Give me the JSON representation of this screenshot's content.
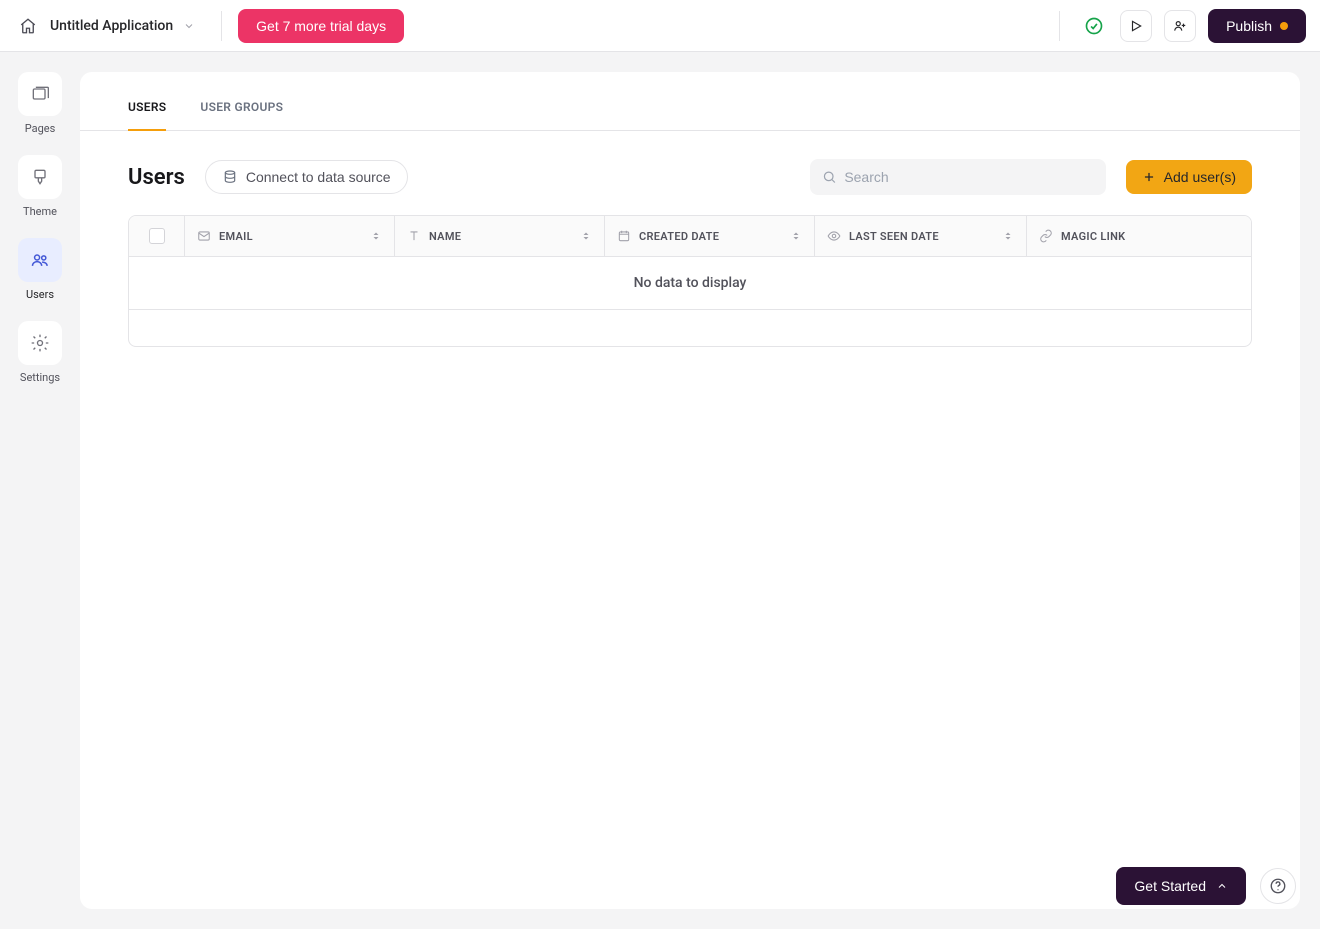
{
  "topbar": {
    "app_title": "Untitled Application",
    "trial_button": "Get 7 more trial days",
    "publish_button": "Publish"
  },
  "sidebar": {
    "pages": "Pages",
    "theme": "Theme",
    "users": "Users",
    "settings": "Settings",
    "active": "users"
  },
  "tabs": {
    "users": "USERS",
    "user_groups": "USER GROUPS",
    "active": "users"
  },
  "page": {
    "title": "Users",
    "datasource_button": "Connect to data source",
    "search_placeholder": "Search",
    "add_user_button": "Add user(s)"
  },
  "table": {
    "columns": {
      "email": "EMAIL",
      "name": "NAME",
      "created_date": "CREATED DATE",
      "last_seen_date": "LAST SEEN DATE",
      "magic_link": "MAGIC LINK"
    },
    "rows": [],
    "empty_message": "No data to display"
  },
  "floating": {
    "get_started": "Get Started"
  },
  "colors": {
    "accent_pink": "#ec3466",
    "accent_amber": "#f2a614",
    "brand_dark": "#2b1235",
    "status_green": "#16a34a",
    "sidebar_active_bg": "#e8edff",
    "sidebar_active_fg": "#4358d6"
  }
}
